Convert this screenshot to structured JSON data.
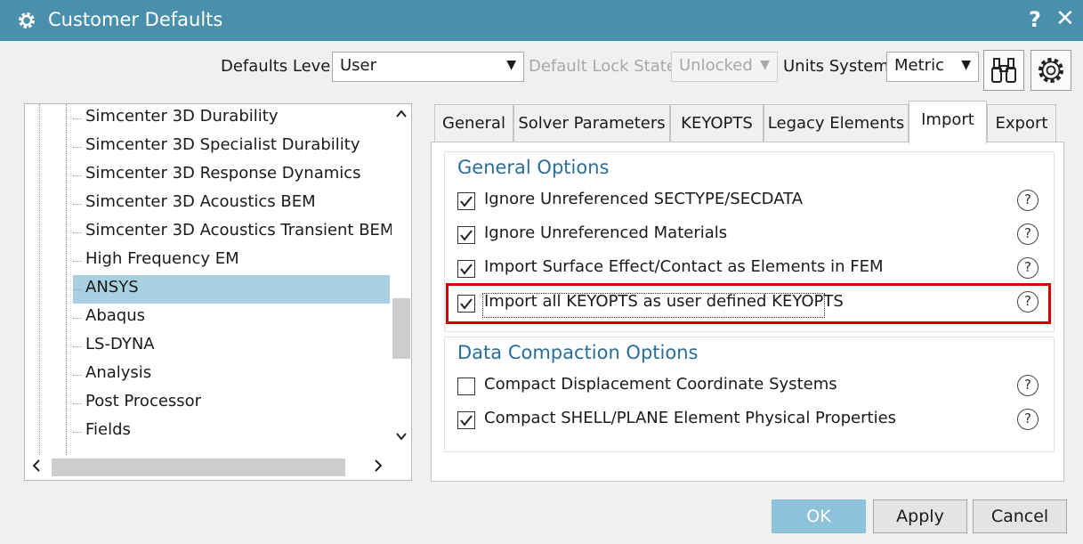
{
  "window": {
    "title": "Customer Defaults",
    "help_glyph": "?",
    "close_glyph": "✕",
    "icon": "gear-icon"
  },
  "toolbar": {
    "defaults_level_label": "Defaults Level",
    "defaults_level_value": "User",
    "lock_state_label": "Default Lock State",
    "lock_state_value": "Unlocked",
    "units_label": "Units System",
    "units_value": "Metric",
    "find_icon": "binoculars-icon",
    "settings_icon": "gear-icon"
  },
  "tree": {
    "items": [
      {
        "label": "Simcenter 3D Durability",
        "selected": false
      },
      {
        "label": "Simcenter 3D Specialist Durability",
        "selected": false
      },
      {
        "label": "Simcenter 3D Response Dynamics",
        "selected": false
      },
      {
        "label": "Simcenter 3D Acoustics BEM",
        "selected": false
      },
      {
        "label": "Simcenter 3D Acoustics Transient BEM",
        "selected": false
      },
      {
        "label": "High Frequency EM",
        "selected": false
      },
      {
        "label": "ANSYS",
        "selected": true
      },
      {
        "label": "Abaqus",
        "selected": false
      },
      {
        "label": "LS-DYNA",
        "selected": false
      },
      {
        "label": "Analysis",
        "selected": false
      },
      {
        "label": "Post Processor",
        "selected": false
      },
      {
        "label": "Fields",
        "selected": false
      }
    ]
  },
  "tabs": [
    {
      "label": "General",
      "active": false
    },
    {
      "label": "Solver Parameters",
      "active": false
    },
    {
      "label": "KEYOPTS",
      "active": false
    },
    {
      "label": "Legacy Elements",
      "active": false
    },
    {
      "label": "Import",
      "active": true
    },
    {
      "label": "Export",
      "active": false
    }
  ],
  "general_options": {
    "title": "General Options",
    "items": [
      {
        "label": "Ignore Unreferenced SECTYPE/SECDATA",
        "checked": true
      },
      {
        "label": "Ignore Unreferenced Materials",
        "checked": true
      },
      {
        "label": "Import Surface Effect/Contact as Elements in FEM",
        "checked": true
      },
      {
        "label": "Import all KEYOPTS as user defined KEYOPTS",
        "checked": true
      }
    ]
  },
  "data_compaction": {
    "title": "Data Compaction Options",
    "items": [
      {
        "label": "Compact Displacement Coordinate Systems",
        "checked": false
      },
      {
        "label": "Compact SHELL/PLANE Element Physical Properties",
        "checked": true
      }
    ]
  },
  "help_glyph": "?",
  "buttons": {
    "ok": "OK",
    "apply": "Apply",
    "cancel": "Cancel"
  },
  "colors": {
    "titlebar": "#4a90ad",
    "selection": "#a8d0e0",
    "group_title": "#2a6f9a",
    "highlight": "#d40000",
    "ok_button": "#8ec2d8"
  }
}
